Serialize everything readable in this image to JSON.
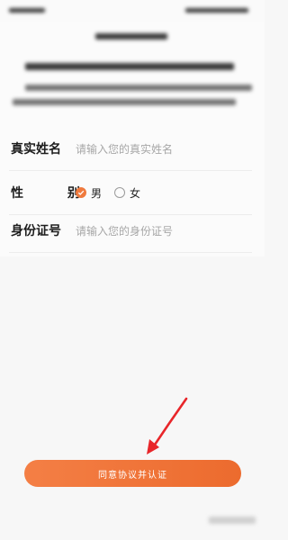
{
  "form": {
    "name_label": "真实姓名",
    "name_placeholder": "请输入您的真实姓名",
    "gender_label": "性 别",
    "gender_options": [
      {
        "label": "男",
        "checked": true
      },
      {
        "label": "女",
        "checked": false
      }
    ],
    "id_label": "身份证号",
    "id_placeholder": "请输入您的身份证号"
  },
  "submit_label": "同意协议并认证",
  "colors": {
    "accent": "#ef7a3e",
    "annotation_arrow": "#e8262a"
  }
}
